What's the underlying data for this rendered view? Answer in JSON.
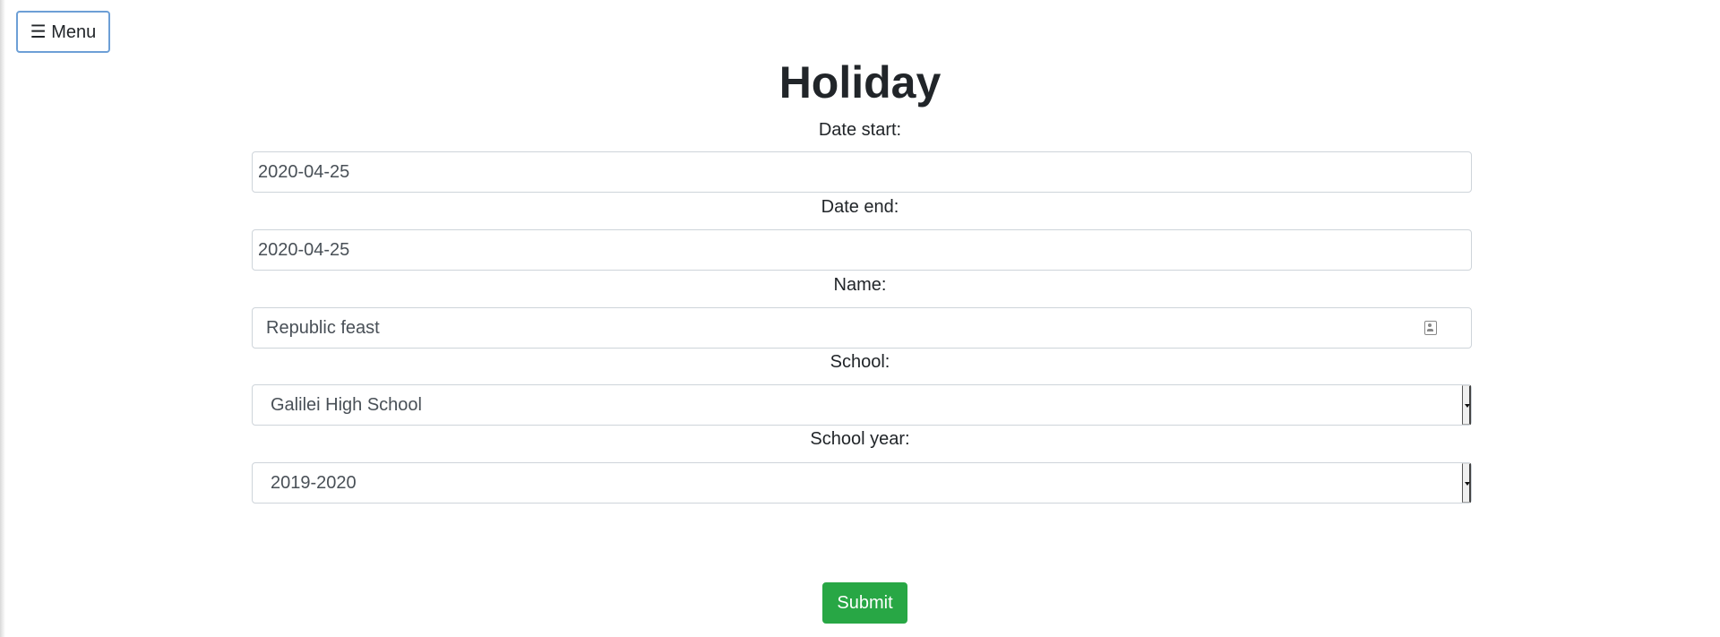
{
  "menu": {
    "label": "☰ Menu"
  },
  "page": {
    "title": "Holiday"
  },
  "form": {
    "date_start": {
      "label": "Date start:",
      "value": "2020-04-25"
    },
    "date_end": {
      "label": "Date end:",
      "value": "2020-04-25"
    },
    "name": {
      "label": "Name:",
      "value": "Republic feast",
      "icon": "contact-card-icon"
    },
    "school": {
      "label": "School:",
      "value": "Galilei High School"
    },
    "school_year": {
      "label": "School year:",
      "value": "2019-2020"
    },
    "submit_label": "Submit"
  },
  "colors": {
    "submit": "#28a745",
    "menu_border": "#6d9fd6",
    "input_border": "#ced4da"
  }
}
